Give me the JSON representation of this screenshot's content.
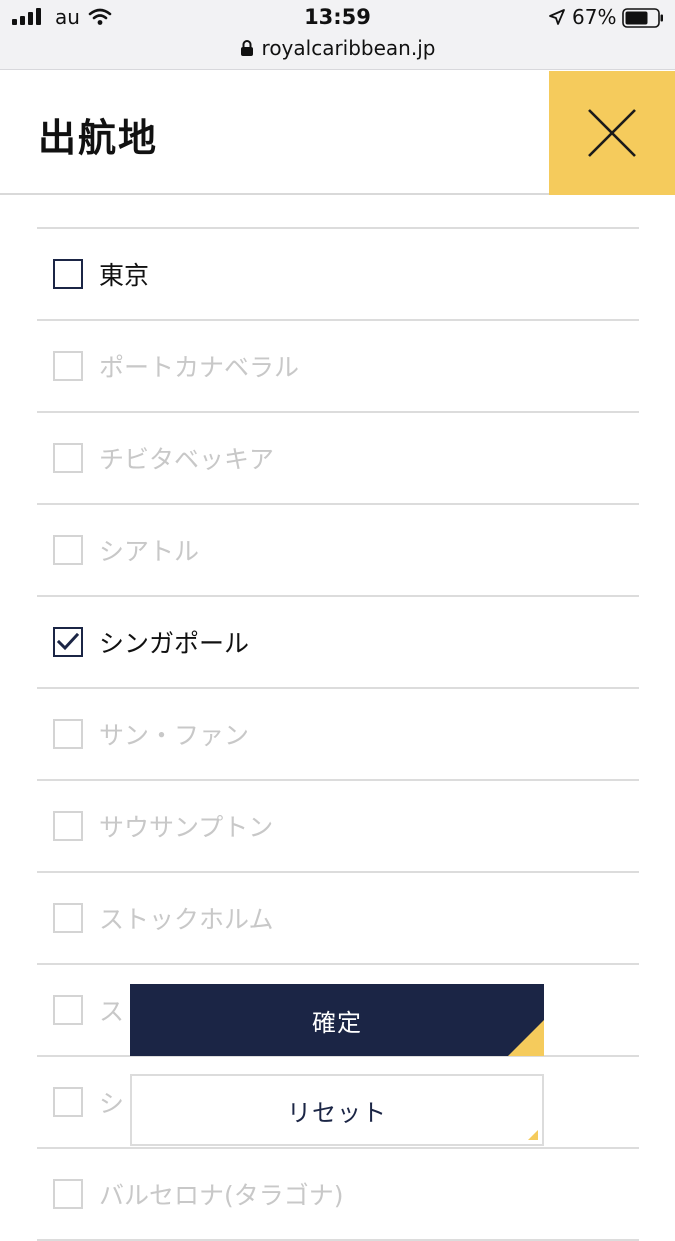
{
  "status_bar": {
    "carrier": "au",
    "time": "13:59",
    "battery": "67%",
    "url": "royalcaribbean.jp"
  },
  "panel": {
    "title": "出航地",
    "close_icon": "close-icon"
  },
  "ports": [
    {
      "label": "東京",
      "checked": false,
      "enabled": true
    },
    {
      "label": "ポートカナベラル",
      "checked": false,
      "enabled": false
    },
    {
      "label": "チビタベッキア",
      "checked": false,
      "enabled": false
    },
    {
      "label": "シアトル",
      "checked": false,
      "enabled": false
    },
    {
      "label": "シンガポール",
      "checked": true,
      "enabled": true
    },
    {
      "label": "サン・ファン",
      "checked": false,
      "enabled": false
    },
    {
      "label": "サウサンプトン",
      "checked": false,
      "enabled": false
    },
    {
      "label": "ストックホルム",
      "checked": false,
      "enabled": false
    },
    {
      "label": "ス",
      "checked": false,
      "enabled": false
    },
    {
      "label": "シ",
      "checked": false,
      "enabled": false
    },
    {
      "label": "バルセロナ(タラゴナ)",
      "checked": false,
      "enabled": false
    }
  ],
  "actions": {
    "confirm_label": "確定",
    "reset_label": "リセット"
  },
  "colors": {
    "accent": "#f5cb5c",
    "navy": "#1b2545",
    "disabled_text": "#c8c8c8",
    "divider": "#dcdcdc"
  }
}
